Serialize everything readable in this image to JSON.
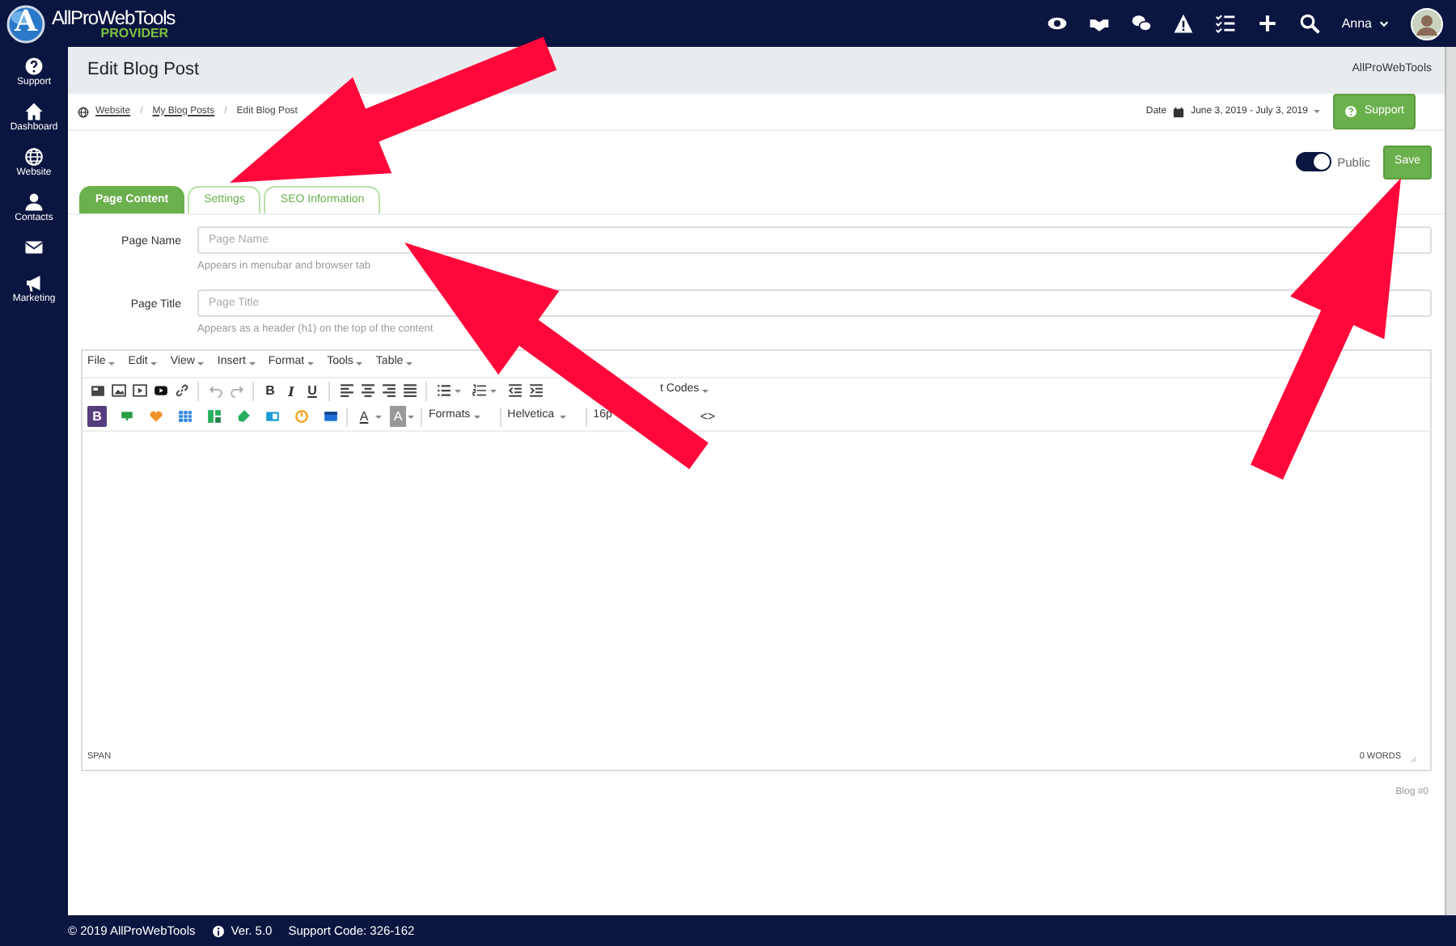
{
  "brand": {
    "mark": "A",
    "name": "AllProWebTools",
    "tagline": "PROVIDER"
  },
  "topbar": {
    "user": "Anna"
  },
  "sidebar": {
    "items": [
      {
        "label": "Support"
      },
      {
        "label": "Dashboard"
      },
      {
        "label": "Website"
      },
      {
        "label": "Contacts"
      },
      {
        "kind": "icon_only"
      },
      {
        "label": "Marketing"
      }
    ]
  },
  "header": {
    "title": "Edit Blog Post",
    "account": "AllProWebTools"
  },
  "breadcrumb": [
    {
      "kind": "link",
      "text": "Website"
    },
    {
      "kind": "separator",
      "text": "/"
    },
    {
      "kind": "link",
      "text": "My Blog Posts"
    },
    {
      "kind": "separator",
      "text": "/"
    },
    {
      "kind": "current",
      "text": "Edit Blog Post"
    }
  ],
  "date_filter": {
    "label": "Date",
    "range": "June 3, 2019 - July 3, 2019"
  },
  "support_button": "Support",
  "public_toggle": {
    "label": "Public",
    "on": true
  },
  "save_button": "Save",
  "tabs": [
    {
      "label": "Page Content",
      "selected": true
    },
    {
      "label": "Settings",
      "selected": false
    },
    {
      "label": "SEO Information",
      "selected": false
    }
  ],
  "fields": [
    {
      "label": "Page Name",
      "placeholder": "Page Name",
      "help": "Appears in menubar and browser tab"
    },
    {
      "label": "Page Title",
      "placeholder": "Page Title",
      "help": "Appears as a header (h1) on the top of the content"
    }
  ],
  "editor": {
    "menu": [
      "File",
      "Edit",
      "View",
      "Insert",
      "Format",
      "Tools",
      "Table"
    ],
    "bold": "B",
    "italic": "I",
    "underline": "U",
    "codes": "t Codes",
    "brand_button": "B",
    "font_color": "A",
    "bg_color": "A",
    "formats": "Formats",
    "font": "Helvetica",
    "size": "16p",
    "source": "<>",
    "path": "SPAN",
    "word_count": "0 WORDS"
  },
  "record_label": "Blog #0",
  "footer": {
    "copyright": "© 2019 AllProWebTools",
    "version": "Ver. 5.0",
    "support_code": "Support Code: 326-162"
  }
}
